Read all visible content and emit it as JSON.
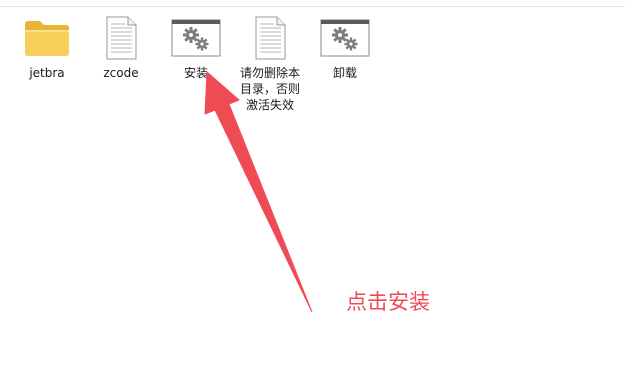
{
  "files": [
    {
      "id": "jetbra",
      "label": "jetbra",
      "type": "folder"
    },
    {
      "id": "zcode",
      "label": "zcode",
      "type": "document"
    },
    {
      "id": "install",
      "label": "安装",
      "type": "batch-script"
    },
    {
      "id": "readme",
      "label": "请勿删除本\n目录，否则\n激活失效",
      "type": "document"
    },
    {
      "id": "uninstall",
      "label": "卸载",
      "type": "batch-script"
    }
  ],
  "annotation": {
    "text": "点击安装",
    "color": "#ee4b55"
  }
}
